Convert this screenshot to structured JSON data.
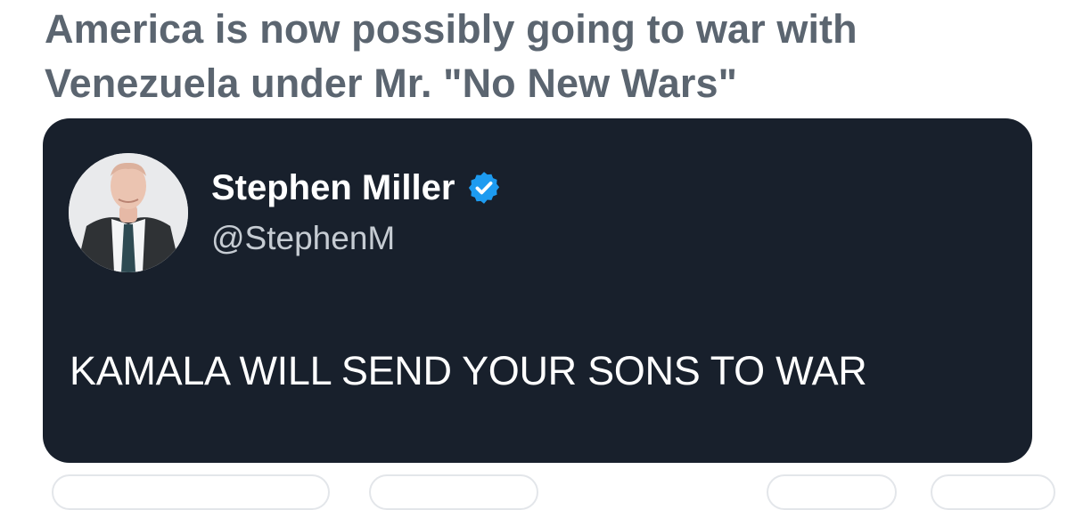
{
  "post": {
    "text": "America is now possibly going to war with Venezuela under Mr. \"No New Wars\""
  },
  "embedded_tweet": {
    "author_name": "Stephen Miller",
    "author_handle": "@StephenM",
    "verified": true,
    "verified_badge_icon": "verified-badge-icon",
    "avatar_icon": "profile-photo",
    "text": "KAMALA WILL SEND YOUR SONS TO WAR"
  },
  "colors": {
    "post_text": "#5b6570",
    "card_background": "#18202c",
    "tweet_text": "#ffffff",
    "handle_text": "#c6ccd3",
    "verified_badge": "#1d9bf0"
  }
}
